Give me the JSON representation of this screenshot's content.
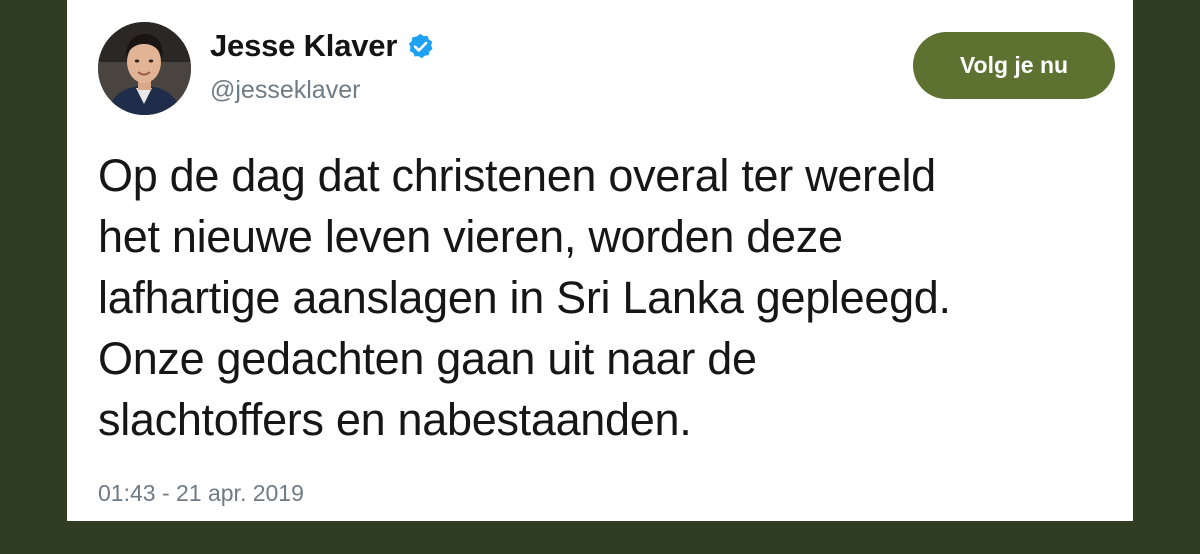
{
  "tweet": {
    "author": {
      "display_name": "Jesse Klaver",
      "handle": "@jesseklaver",
      "verified_icon": "verified-badge-icon",
      "avatar": "profile-photo"
    },
    "follow_button_label": "Volg je nu",
    "text": "Op de dag dat christenen overal ter wereld\nhet nieuwe leven vieren, worden deze\nlafhartige aanslagen in Sri Lanka gepleegd.\nOnze gedachten gaan uit naar de\nslachtoffers en nabestaanden.",
    "timestamp": "01:43 - 21 apr. 2019"
  },
  "colors": {
    "background": "#2f3d23",
    "card": "#ffffff",
    "follow_button": "#5d7131",
    "verified": "#1da1f2",
    "secondary_text": "#6f7b85"
  }
}
